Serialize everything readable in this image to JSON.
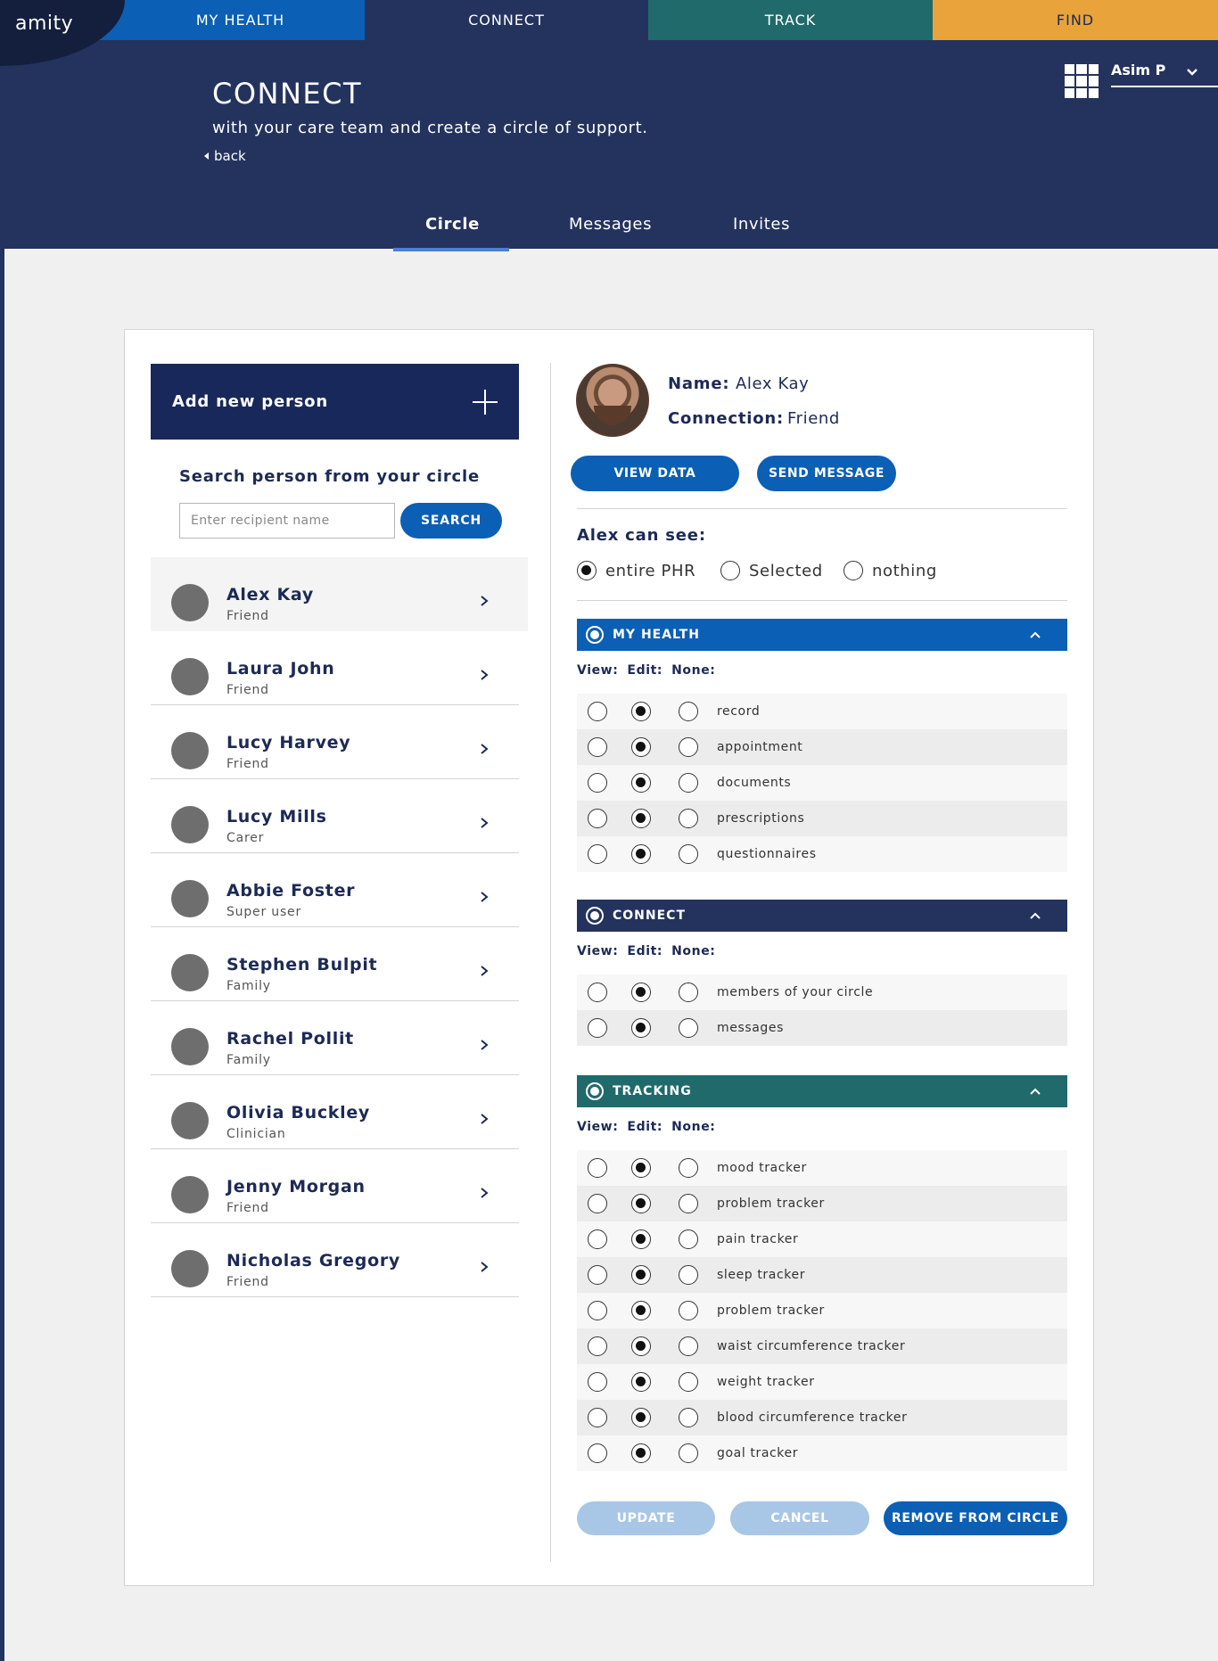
{
  "brand": {
    "logo": "amity"
  },
  "topnav": {
    "my_health": "MY HEALTH",
    "connect": "CONNECT",
    "track": "TRACK",
    "find": "FIND"
  },
  "user": {
    "name": "Asim P",
    "menu_icon": "chevron-down-icon",
    "apps_icon": "grid-icon"
  },
  "page": {
    "title": "CONNECT",
    "subtitle": "with your care team and create a circle of support.",
    "back": "back"
  },
  "subtabs": {
    "circle": "Circle",
    "messages": "Messages",
    "invites": "Invites",
    "active": "Circle"
  },
  "sidebar": {
    "add_person": "Add new person",
    "search_title": "Search person from your circle",
    "search_placeholder": "Enter recipient name",
    "search_button": "SEARCH",
    "people": [
      {
        "name": "Alex Kay",
        "role": "Friend"
      },
      {
        "name": "Laura John",
        "role": "Friend"
      },
      {
        "name": "Lucy Harvey",
        "role": "Friend"
      },
      {
        "name": "Lucy Mills",
        "role": "Carer"
      },
      {
        "name": "Abbie Foster",
        "role": "Super user"
      },
      {
        "name": "Stephen Bulpit",
        "role": "Family"
      },
      {
        "name": "Rachel Pollit",
        "role": "Family"
      },
      {
        "name": "Olivia Buckley",
        "role": "Clinician"
      },
      {
        "name": "Jenny Morgan",
        "role": "Friend"
      },
      {
        "name": "Nicholas Gregory",
        "role": "Friend"
      }
    ]
  },
  "detail": {
    "name_label": "Name:",
    "name_value": "Alex Kay",
    "connection_label": "Connection:",
    "connection_value": "Friend",
    "view_data": "VIEW DATA",
    "send_message": "SEND MESSAGE",
    "can_see_title": "Alex can see:",
    "access_options": {
      "entire": "entire PHR",
      "selected": "Selected",
      "nothing": "nothing",
      "current": "entire PHR"
    },
    "col_view": "View:",
    "col_edit": "Edit:",
    "col_none": "None:",
    "sections": {
      "my_health": {
        "title": "MY HEALTH",
        "items": [
          "record",
          "appointment",
          "documents",
          "prescriptions",
          "questionnaires"
        ]
      },
      "connect": {
        "title": "CONNECT",
        "items": [
          "members of your circle",
          "messages"
        ]
      },
      "tracking": {
        "title": "TRACKING",
        "items": [
          "mood tracker",
          "problem tracker",
          "pain tracker",
          "sleep tracker",
          "problem tracker",
          "waist circumference tracker",
          "weight tracker",
          "blood circumference tracker",
          "goal tracker"
        ]
      }
    },
    "selected_permission": "Edit",
    "update": "UPDATE",
    "cancel": "CANCEL",
    "remove": "REMOVE FROM CIRCLE"
  },
  "colors": {
    "navy": "#24335e",
    "blue": "#0b5fb4",
    "teal": "#206a6b",
    "gold": "#e8a33a",
    "disabled": "#a8c7e6"
  }
}
